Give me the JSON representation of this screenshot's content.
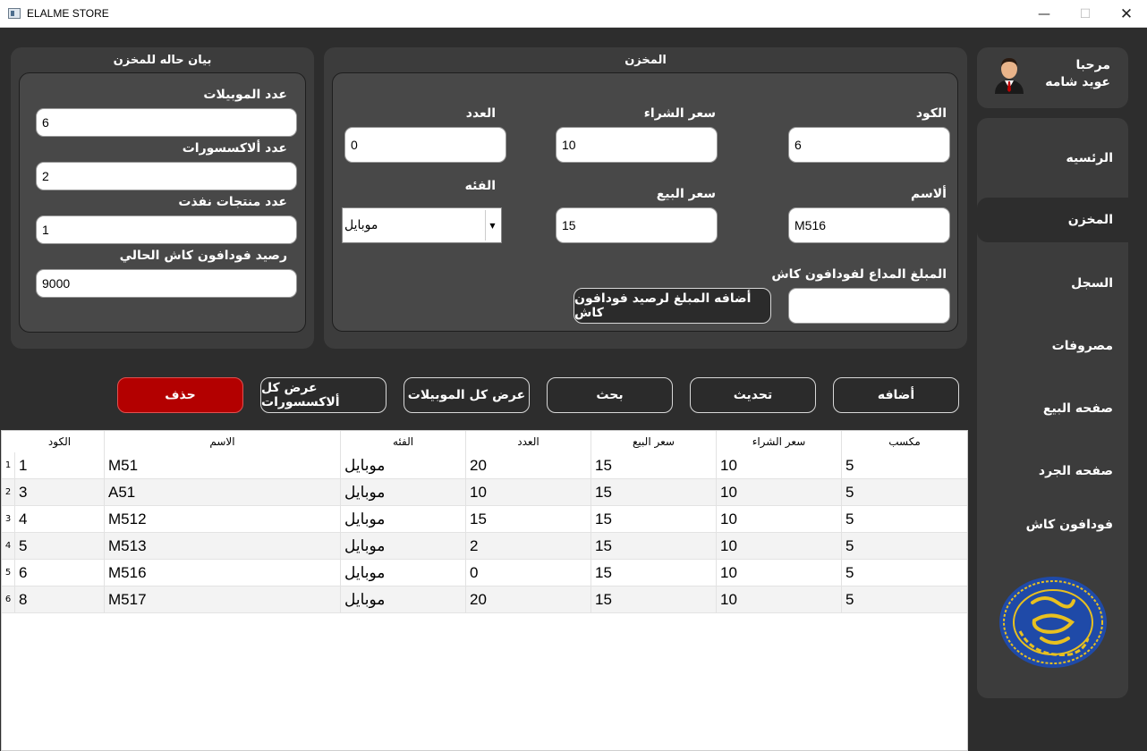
{
  "window": {
    "title": "ELALME STORE",
    "min_glyph": "—",
    "max_glyph": "☐",
    "close_glyph": "✕"
  },
  "user": {
    "greeting": "مرحبا",
    "name": "عويد شامه"
  },
  "sidebar": {
    "items": [
      {
        "label": "الرئسيه"
      },
      {
        "label": "المخزن"
      },
      {
        "label": "السجل"
      },
      {
        "label": "مصروفات"
      },
      {
        "label": "صفحه البيع"
      },
      {
        "label": "صفحه الجرد"
      },
      {
        "label": "فودافون كاش"
      }
    ]
  },
  "status_panel": {
    "title": "بيان حاله للمخزن",
    "mobiles_label": "عدد الموبيلات",
    "mobiles_value": "6",
    "accessories_label": "عدد ألاكسسورات",
    "accessories_value": "2",
    "out_of_stock_label": "عدد منتجات نفذت",
    "out_of_stock_value": "1",
    "vodafone_balance_label": "رصيد فودافون كاش  الحالي",
    "vodafone_balance_value": "9000"
  },
  "store_panel": {
    "title": "المخزن",
    "code_label": "الكود",
    "code_value": "6",
    "buy_price_label": "سعر الشراء",
    "buy_price_value": "10",
    "qty_label": "العدد",
    "qty_value": "0",
    "name_label": "ألاسم",
    "name_value": "M516",
    "sell_price_label": "سعر البيع",
    "sell_price_value": "15",
    "category_label": "الفئه",
    "category_value": "موبايل",
    "vodafone_amount_label": "المبلغ المداع لفودافون كاش",
    "vodafone_amount_value": "",
    "add_to_vodafone_button": "أضافه المبلغ لرصيد فودافون كاش"
  },
  "actions": {
    "add": "أضافه",
    "update": "تحديث",
    "search": "بحث",
    "show_mobiles": "عرض كل الموبيلات",
    "show_accessories": "عرض كل ألاكسسورات",
    "delete": "حذف"
  },
  "table": {
    "headers": [
      "الكود",
      "الاسم",
      "الفئه",
      "العدد",
      "سعر البيع",
      "سعر الشراء",
      "مكسب"
    ],
    "rows": [
      {
        "num": "1",
        "cells": [
          "1",
          "M51",
          "موبايل",
          "20",
          "15",
          "10",
          "5"
        ]
      },
      {
        "num": "2",
        "cells": [
          "3",
          "A51",
          "موبايل",
          "10",
          "15",
          "10",
          "5"
        ]
      },
      {
        "num": "3",
        "cells": [
          "4",
          "M512",
          "موبايل",
          "15",
          "15",
          "10",
          "5"
        ]
      },
      {
        "num": "4",
        "cells": [
          "5",
          "M513",
          "موبايل",
          "2",
          "15",
          "10",
          "5"
        ]
      },
      {
        "num": "5",
        "cells": [
          "6",
          "M516",
          "موبايل",
          "0",
          "15",
          "10",
          "5"
        ]
      },
      {
        "num": "6",
        "cells": [
          "8",
          "M517",
          "موبايل",
          "20",
          "15",
          "10",
          "5"
        ]
      }
    ]
  },
  "colors": {
    "background": "#2d2d2d",
    "panel": "#3c3c3c",
    "inner_panel": "#484848",
    "delete": "#b30000",
    "logo_blue": "#1f4aa8",
    "logo_gold": "#e8c020"
  }
}
